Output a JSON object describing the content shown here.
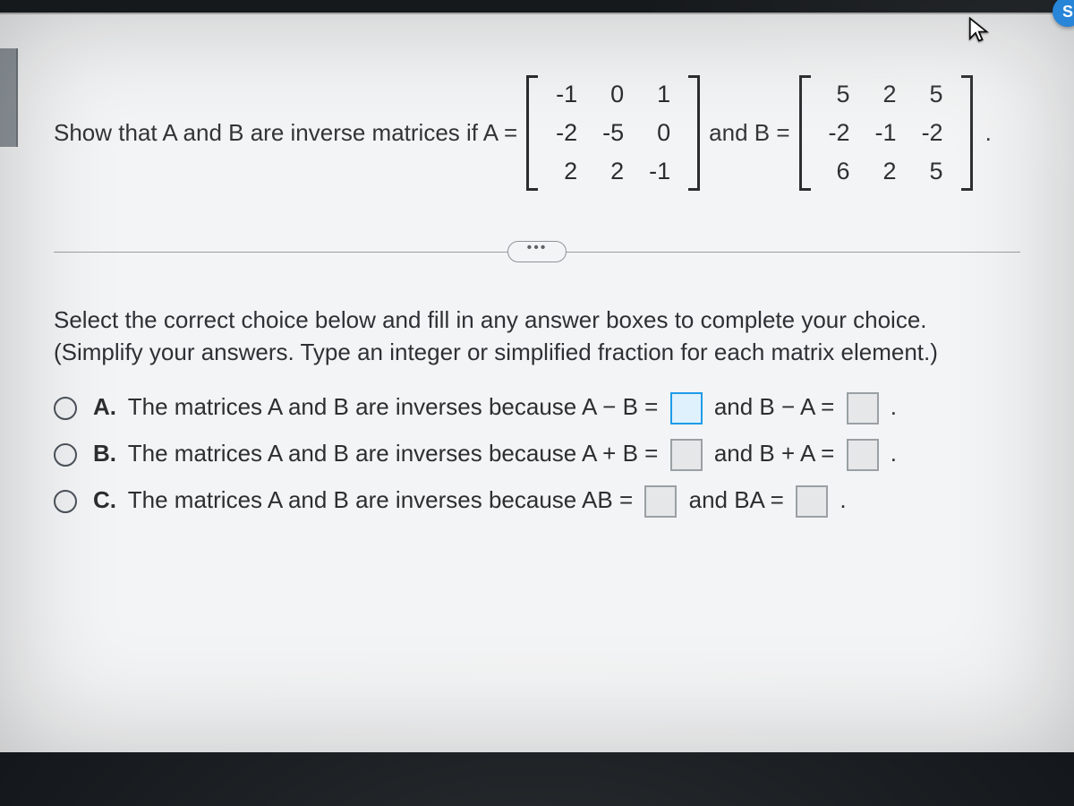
{
  "question": {
    "lead": "Show that A and B are inverse matrices if A =",
    "matrixA": [
      [
        "-1",
        "0",
        "1"
      ],
      [
        "-2",
        "-5",
        "0"
      ],
      [
        "2",
        "2",
        "-1"
      ]
    ],
    "mid": "and B =",
    "matrixB": [
      [
        "5",
        "2",
        "5"
      ],
      [
        "-2",
        "-1",
        "-2"
      ],
      [
        "6",
        "2",
        "5"
      ]
    ],
    "tail": "."
  },
  "ellipsis": "•••",
  "instructions": {
    "line1": "Select the correct choice below and fill in any answer boxes to complete your choice.",
    "line2": "(Simplify your answers. Type an integer or simplified fraction for each matrix element.)"
  },
  "choices": {
    "a": {
      "letter": "A.",
      "pre": "The matrices A and B are inverses because A − B =",
      "mid": "and B − A =",
      "post": "."
    },
    "b": {
      "letter": "B.",
      "pre": "The matrices A and B are inverses because A + B =",
      "mid": "and B + A =",
      "post": "."
    },
    "c": {
      "letter": "C.",
      "pre": "The matrices A and B are inverses because AB =",
      "mid": "and BA =",
      "post": "."
    }
  },
  "badge": "S"
}
